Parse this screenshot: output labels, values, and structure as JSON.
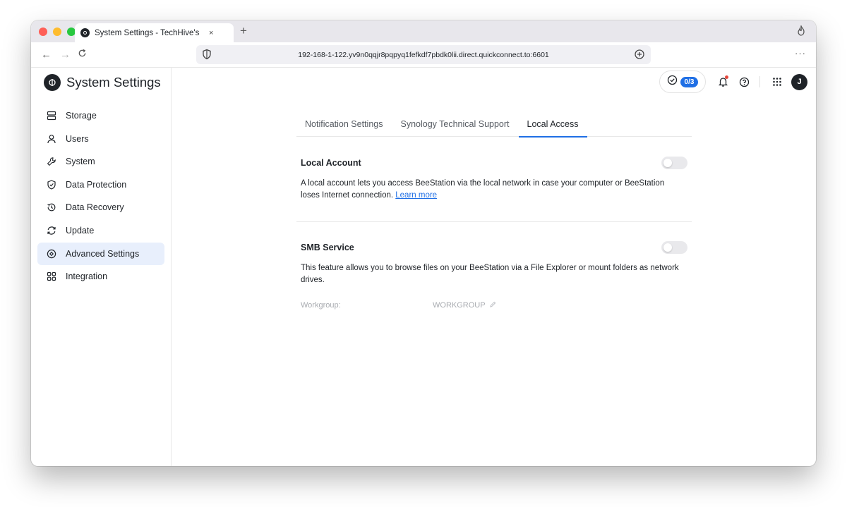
{
  "browser": {
    "tab_title": "System Settings - TechHive's",
    "tab_close": "×",
    "new_tab": "+",
    "url": "192-168-1-122.yv9n0qqjr8pqpyq1fefkdf7pbdk0lii.direct.quickconnect.to:6601",
    "more": "···"
  },
  "app": {
    "title": "System Settings"
  },
  "sidebar": {
    "items": [
      {
        "label": "Storage",
        "icon": "storage-icon"
      },
      {
        "label": "Users",
        "icon": "user-icon"
      },
      {
        "label": "System",
        "icon": "wrench-icon"
      },
      {
        "label": "Data Protection",
        "icon": "shield-icon"
      },
      {
        "label": "Data Recovery",
        "icon": "history-icon"
      },
      {
        "label": "Update",
        "icon": "refresh-icon"
      },
      {
        "label": "Advanced Settings",
        "icon": "advanced-icon",
        "active": true
      },
      {
        "label": "Integration",
        "icon": "grid-icon"
      }
    ]
  },
  "topbar": {
    "task_count": "0/3",
    "avatar_initial": "J"
  },
  "tabs": [
    {
      "label": "Notification Settings"
    },
    {
      "label": "Synology Technical Support"
    },
    {
      "label": "Local Access",
      "active": true
    }
  ],
  "local_account": {
    "title": "Local Account",
    "description": "A local account lets you access BeeStation via the local network in case your computer or BeeStation loses Internet connection.",
    "link": "Learn more",
    "enabled": false
  },
  "smb": {
    "title": "SMB Service",
    "description": "This feature allows you to browse files on your BeeStation via a File Explorer or mount folders as network drives.",
    "enabled": false,
    "workgroup_label": "Workgroup:",
    "workgroup_value": "WORKGROUP"
  },
  "colors": {
    "accent": "#1f6fe5",
    "active_nav_bg": "#e8effc",
    "notification_dot": "#e5483d"
  }
}
